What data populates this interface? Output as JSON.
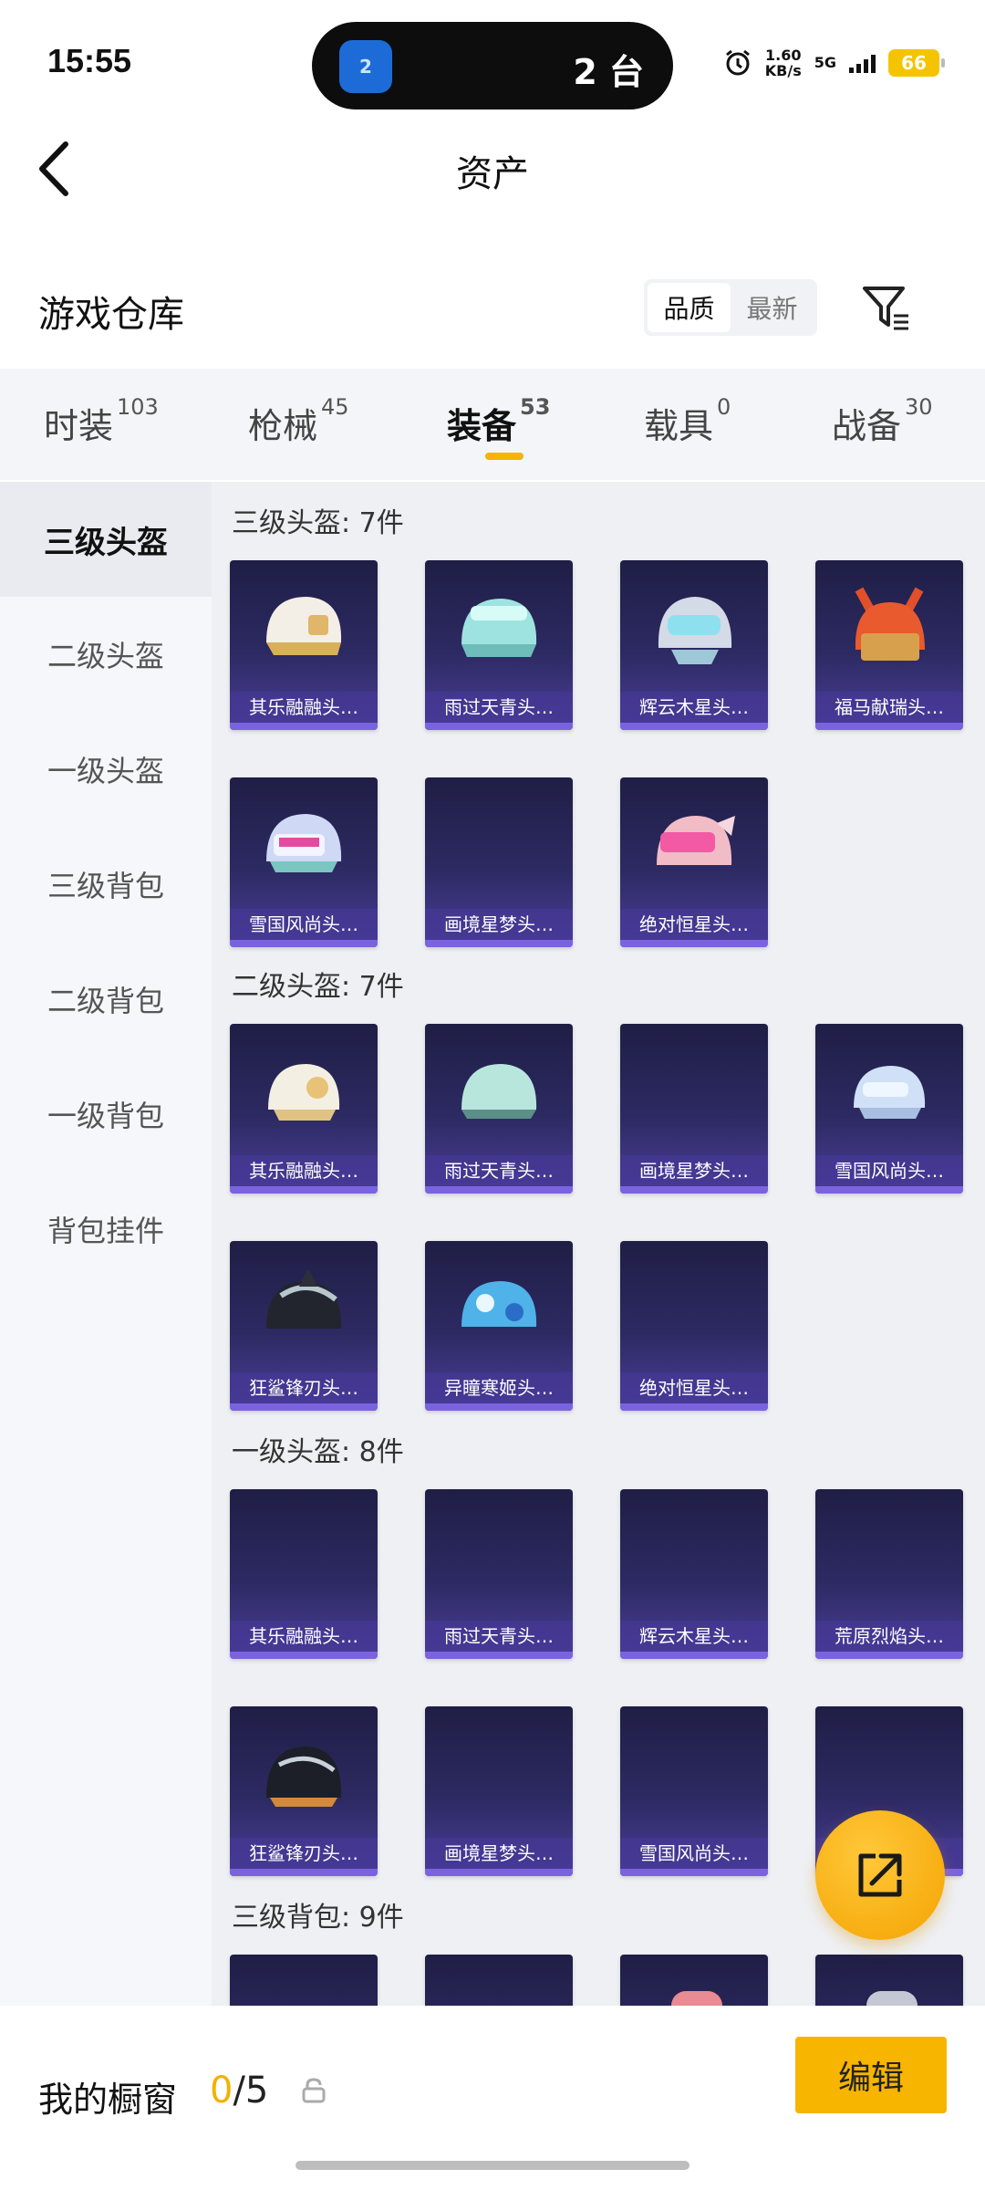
{
  "status_bar": {
    "time": "15:55",
    "hotspot_count": "2 台",
    "hotspot_icon_badge": "2",
    "net_speed_value": "1.60",
    "net_speed_unit": "KB/s",
    "network": "5G",
    "battery": "66"
  },
  "header": {
    "title": "资产"
  },
  "warehouse": {
    "title": "游戏仓库",
    "sort": [
      "品质",
      "最新"
    ]
  },
  "tabs": [
    {
      "label": "时装",
      "count": "103"
    },
    {
      "label": "枪械",
      "count": "45"
    },
    {
      "label": "装备",
      "count": "53"
    },
    {
      "label": "载具",
      "count": "0"
    },
    {
      "label": "战备",
      "count": "30"
    }
  ],
  "sidebar": [
    "三级头盔",
    "二级头盔",
    "一级头盔",
    "三级背包",
    "二级背包",
    "一级背包",
    "背包挂件"
  ],
  "sections": [
    {
      "title": "三级头盔: 7件",
      "items": [
        "其乐融融头…",
        "雨过天青头…",
        "辉云木星头…",
        "福马献瑞头…",
        "雪国风尚头…",
        "画境星梦头…",
        "绝对恒星头…"
      ]
    },
    {
      "title": "二级头盔: 7件",
      "items": [
        "其乐融融头…",
        "雨过天青头…",
        "画境星梦头…",
        "雪国风尚头…",
        "狂鲨锋刃头…",
        "异瞳寒姬头…",
        "绝对恒星头…"
      ]
    },
    {
      "title": "一级头盔: 8件",
      "items": [
        "其乐融融头…",
        "雨过天青头…",
        "辉云木星头…",
        "荒原烈焰头…",
        "狂鲨锋刃头…",
        "画境星梦头…",
        "雪国风尚头…",
        ""
      ]
    },
    {
      "title": "三级背包: 9件",
      "items": [
        "",
        "",
        "",
        ""
      ]
    }
  ],
  "bottom_bar": {
    "label": "我的橱窗",
    "current": "0",
    "total": "/5",
    "edit": "编辑"
  },
  "colors": {
    "accent": "#f7b500",
    "card_top": "#1f1e45",
    "card_bottom": "#4a3f9a"
  }
}
